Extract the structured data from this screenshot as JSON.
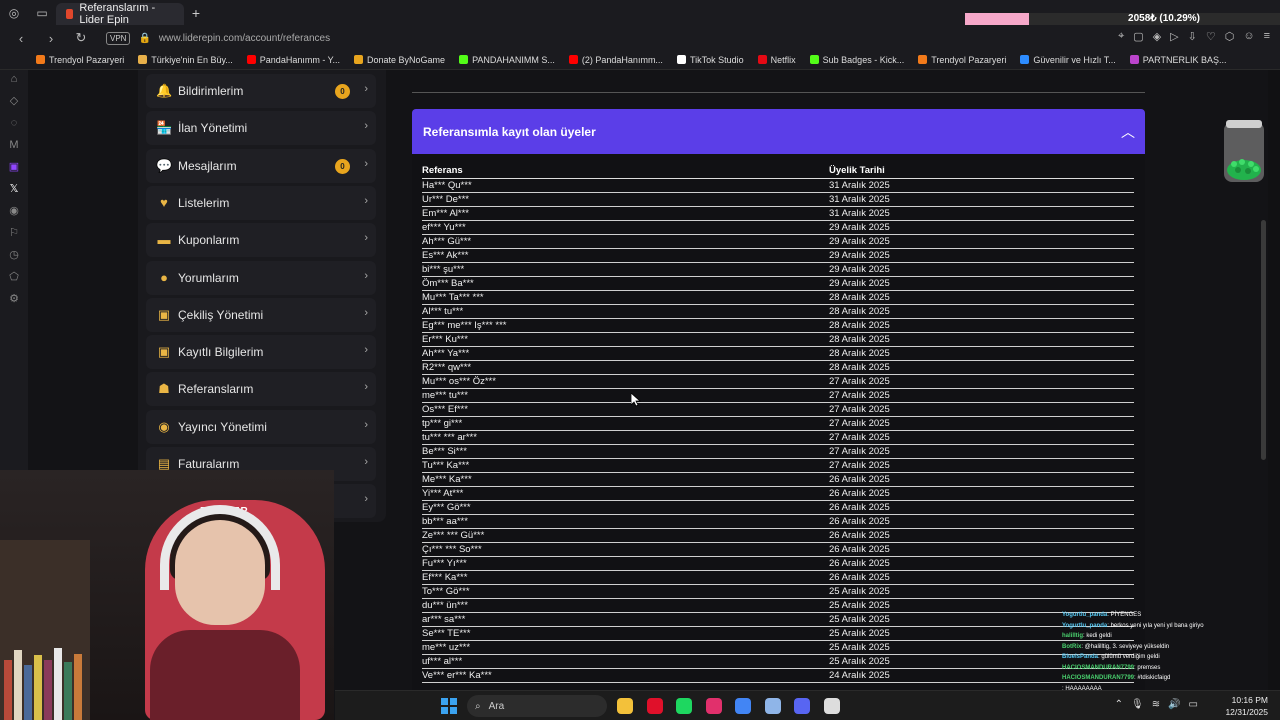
{
  "browser": {
    "tab_title": "Referanslarım - Lider Epin",
    "url": "www.liderepin.com/account/referances",
    "vpn_label": "VPN",
    "new_tab": "+"
  },
  "overlay": {
    "progress_text": "2058₺ (10.29%)",
    "progress_fraction": 0.1029
  },
  "bookmarks": [
    {
      "label": "Trendyol Pazaryeri",
      "color": "#f27a1a"
    },
    {
      "label": "Türkiye'nin En Büy...",
      "color": "#e8b04a"
    },
    {
      "label": "PandaHanımm - Y...",
      "color": "#ff0000"
    },
    {
      "label": "Donate ByNoGame",
      "color": "#e8a51e"
    },
    {
      "label": "PANDAHANIMM S...",
      "color": "#53fc18"
    },
    {
      "label": "(2) PandaHanımm...",
      "color": "#ff0000"
    },
    {
      "label": "TikTok Studio",
      "color": "#ffffff"
    },
    {
      "label": "Netflix",
      "color": "#e50914"
    },
    {
      "label": "Sub Badges - Kick...",
      "color": "#53fc18"
    },
    {
      "label": "Trendyol Pazaryeri",
      "color": "#f27a1a"
    },
    {
      "label": "Güvenilir ve Hızlı T...",
      "color": "#2d8cff"
    },
    {
      "label": "PARTNERLIK BAŞ...",
      "color": "#bb44cc"
    }
  ],
  "sidebar": {
    "items": [
      {
        "label": "Bildirimlerim",
        "icon": "bell-icon",
        "glyph": "🔔",
        "badge": "0"
      },
      {
        "label": "İlan Yönetimi",
        "icon": "store-icon",
        "glyph": "🏪",
        "badge": ""
      },
      {
        "label": "Mesajlarım",
        "icon": "chat-icon",
        "glyph": "💬",
        "badge": "0"
      },
      {
        "label": "Listelerim",
        "icon": "heart-icon",
        "glyph": "♥",
        "badge": ""
      },
      {
        "label": "Kuponlarım",
        "icon": "ticket-icon",
        "glyph": "▬",
        "badge": ""
      },
      {
        "label": "Yorumlarım",
        "icon": "comment-icon",
        "glyph": "●",
        "badge": ""
      },
      {
        "label": "Çekiliş Yönetimi",
        "icon": "gift-icon",
        "glyph": "▣",
        "badge": ""
      },
      {
        "label": "Kayıtlı Bilgilerim",
        "icon": "save-icon",
        "glyph": "▣",
        "badge": ""
      },
      {
        "label": "Referanslarım",
        "icon": "users-icon",
        "glyph": "☗",
        "badge": ""
      },
      {
        "label": "Yayıncı Yönetimi",
        "icon": "broadcast-icon",
        "glyph": "◉",
        "badge": ""
      },
      {
        "label": "Faturalarım",
        "icon": "invoice-icon",
        "glyph": "▤",
        "badge": ""
      },
      {
        "label": "",
        "icon": "more-icon",
        "glyph": "",
        "badge": ""
      }
    ]
  },
  "panel": {
    "title": "Referansımla kayıt olan üyeler",
    "col_ref": "Referans",
    "col_date": "Üyelik Tarihi",
    "rows": [
      [
        "Ha*** Qu***",
        "31 Aralık 2025"
      ],
      [
        "Ur*** De***",
        "31 Aralık 2025"
      ],
      [
        "Em*** Al***",
        "31 Aralık 2025"
      ],
      [
        "ef*** Yu***",
        "29 Aralık 2025"
      ],
      [
        "Ah*** Gü***",
        "29 Aralık 2025"
      ],
      [
        "Es*** Ak***",
        "29 Aralık 2025"
      ],
      [
        "bi*** şu***",
        "29 Aralık 2025"
      ],
      [
        "Öm*** Ba***",
        "29 Aralık 2025"
      ],
      [
        "Mu*** Ta*** ***",
        "28 Aralık 2025"
      ],
      [
        "Al*** tu***",
        "28 Aralık 2025"
      ],
      [
        "Eg*** me*** Iş*** ***",
        "28 Aralık 2025"
      ],
      [
        "Er*** Ku***",
        "28 Aralık 2025"
      ],
      [
        "Ah*** Ya***",
        "28 Aralık 2025"
      ],
      [
        "R2*** qw***",
        "28 Aralık 2025"
      ],
      [
        "Mu*** os*** Öz***",
        "27 Aralık 2025"
      ],
      [
        "me*** tu***",
        "27 Aralık 2025"
      ],
      [
        "Os*** Ef***",
        "27 Aralık 2025"
      ],
      [
        "tp*** gi***",
        "27 Aralık 2025"
      ],
      [
        "tu*** *** ar***",
        "27 Aralık 2025"
      ],
      [
        "Be*** Si***",
        "27 Aralık 2025"
      ],
      [
        "Tu*** Ka***",
        "27 Aralık 2025"
      ],
      [
        "Me*** Ka***",
        "26 Aralık 2025"
      ],
      [
        "Yi*** At***",
        "26 Aralık 2025"
      ],
      [
        "Ey*** Gö***",
        "26 Aralık 2025"
      ],
      [
        "bb*** aa***",
        "26 Aralık 2025"
      ],
      [
        "Ze*** *** Gü***",
        "26 Aralık 2025"
      ],
      [
        "Çı*** *** So***",
        "26 Aralık 2025"
      ],
      [
        "Fu*** Yı***",
        "26 Aralık 2025"
      ],
      [
        "Ef*** Ka***",
        "26 Aralık 2025"
      ],
      [
        "To*** Gö***",
        "25 Aralık 2025"
      ],
      [
        "du*** ün***",
        "25 Aralık 2025"
      ],
      [
        "ar*** sa***",
        "25 Aralık 2025"
      ],
      [
        "Se*** TE***",
        "25 Aralık 2025"
      ],
      [
        "me*** uz***",
        "25 Aralık 2025"
      ],
      [
        "uf*** al***",
        "25 Aralık 2025"
      ],
      [
        "Ve*** er*** Ka***",
        "24 Aralık 2025"
      ]
    ]
  },
  "webcam": {
    "chair_brand": "DANCER"
  },
  "chat": [
    {
      "user": "Yogurtlu_panda",
      "msg": ": PİYENGES",
      "style": "u"
    },
    {
      "user": "Yogurtlu_panda",
      "msg": ": berkos yeni yıla yeni yıl bana giriyo",
      "style": "u"
    },
    {
      "user": "halilltig",
      "msg": ": kedi geldi",
      "style": "u2"
    },
    {
      "user": "BotRix",
      "msg": ": @halilltig, 3. seviyeye yükseldin",
      "style": "u2"
    },
    {
      "user": "BlueIsPanda",
      "msg": ": gülümü verdiğim geldi",
      "style": "u"
    },
    {
      "user": "HACIOSMANDURAN7799",
      "msg": ": premses",
      "style": "u2"
    },
    {
      "user": "HACIOSMANDURAN7799",
      "msg": ": #tdiskicfaigd",
      "style": "u2"
    },
    {
      "user": "",
      "msg": ": HAAAAAAAA",
      "style": "u"
    },
    {
      "user": "Yogurtlu_panda",
      "msg": "",
      "style": "u"
    },
    {
      "user": "Yogurtlu_panda",
      "msg": "",
      "style": "u"
    }
  ],
  "taskbar": {
    "search_label": "Ara",
    "time": "10:16 PM",
    "date": "12/31/2025",
    "apps": [
      {
        "name": "file-explorer-icon",
        "color": "#f3c13a"
      },
      {
        "name": "opera-icon",
        "color": "#e0102a"
      },
      {
        "name": "spotify-icon",
        "color": "#1ed760"
      },
      {
        "name": "instagram-icon",
        "color": "#e1306c"
      },
      {
        "name": "chrome-icon",
        "color": "#4285f4"
      },
      {
        "name": "settings-icon",
        "color": "#8fb5e8"
      },
      {
        "name": "discord-icon",
        "color": "#5865f2"
      },
      {
        "name": "obs-icon",
        "color": "#dddddd"
      }
    ]
  }
}
